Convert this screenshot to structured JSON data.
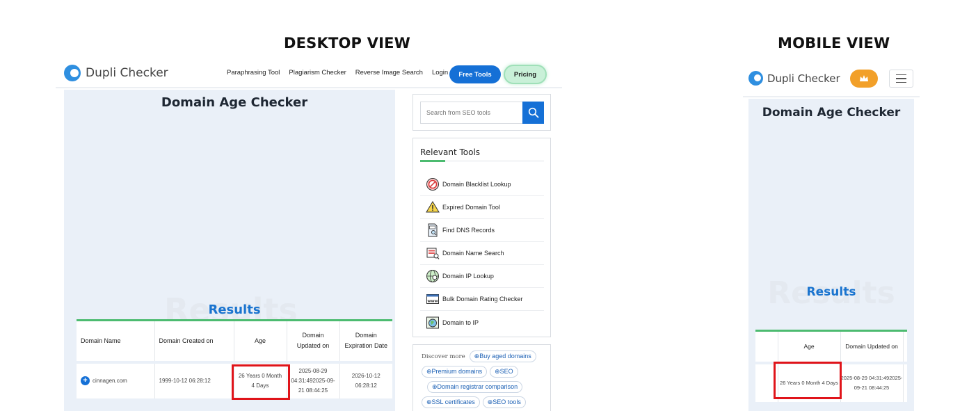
{
  "headings": {
    "desktop": "DESKTOP VIEW",
    "mobile": "MOBILE VIEW"
  },
  "brand": {
    "name": "Dupli Checker",
    "accent": "#1570d6",
    "logo_color": "#2f8fe0"
  },
  "desktop": {
    "nav": {
      "links": [
        "Paraphrasing Tool",
        "Plagiarism Checker",
        "Reverse Image Search",
        "Login"
      ],
      "free_tools": "Free Tools",
      "pricing": "Pricing"
    },
    "page_title": "Domain Age Checker",
    "results_ghost": "Results",
    "results_label": "Results",
    "table": {
      "headers": [
        "Domain Name",
        "Domain Created on",
        "Age",
        "Domain Updated on",
        "Domain Expiration Date"
      ],
      "row": {
        "domain": "cinnagen.com",
        "created": "1999-10-12 06:28:12",
        "age": "26 Years 0 Month 4 Days",
        "updated": "2025-08-29 04:31:492025-09-21 08:44:25",
        "expiration": "2026-10-12 06:28:12"
      }
    },
    "sidebar": {
      "search_placeholder": "Search from SEO tools",
      "relevant_title": "Relevant Tools",
      "tools": [
        {
          "label": "Domain Blacklist Lookup",
          "icon": "blacklist-icon"
        },
        {
          "label": "Expired Domain Tool",
          "icon": "warning-icon"
        },
        {
          "label": "Find DNS Records",
          "icon": "dns-file-icon"
        },
        {
          "label": "Domain Name Search",
          "icon": "search-list-icon"
        },
        {
          "label": "Domain IP Lookup",
          "icon": "ip-globe-icon"
        },
        {
          "label": "Bulk Domain Rating Checker",
          "icon": "www-icon"
        },
        {
          "label": "Domain to IP",
          "icon": "globe-ip-icon"
        }
      ],
      "discover_label": "Discover more",
      "chips": [
        "Buy aged domains",
        "Premium domains",
        "SEO",
        "Domain registrar comparison",
        "SSL certificates",
        "SEO tools"
      ]
    }
  },
  "mobile": {
    "page_title": "Domain Age Checker",
    "results_ghost": "Results",
    "results_label": "Results",
    "table": {
      "headers": [
        "",
        "Age",
        "Domain Updated on",
        ""
      ],
      "row": {
        "age": "26 Years 0 Month 4 Days",
        "updated": "2025-08-29 04:31:492025-09-21 08:44:25"
      }
    }
  },
  "colors": {
    "highlight_box": "#e0141a",
    "table_accent": "#4cbb70",
    "premium_button": "#f2a029"
  }
}
